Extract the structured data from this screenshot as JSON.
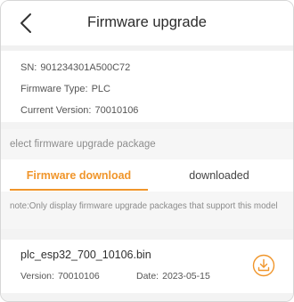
{
  "header": {
    "title": "Firmware upgrade",
    "back_icon": "chevron-left-icon"
  },
  "device_info": {
    "sn_label": "SN:",
    "sn_value": "901234301A500C72",
    "type_label": "Firmware Type:",
    "type_value": "PLC",
    "version_label": "Current Version:",
    "version_value": "70010106"
  },
  "section": {
    "label": "elect firmware upgrade package"
  },
  "tabs": [
    {
      "label": "Firmware download",
      "active": true
    },
    {
      "label": "downloaded",
      "active": false
    }
  ],
  "note": "note:Only display firmware upgrade packages that support this model",
  "files": [
    {
      "name": "plc_esp32_700_10106.bin",
      "version_label": "Version:",
      "version_value": "70010106",
      "date_label": "Date:",
      "date_value": "2023-05-15",
      "action_icon": "download-icon"
    }
  ],
  "colors": {
    "accent": "#f0952a",
    "text_primary": "#2b2b2b",
    "text_secondary": "#8b8b8b",
    "background_band": "#f3f3f3"
  }
}
